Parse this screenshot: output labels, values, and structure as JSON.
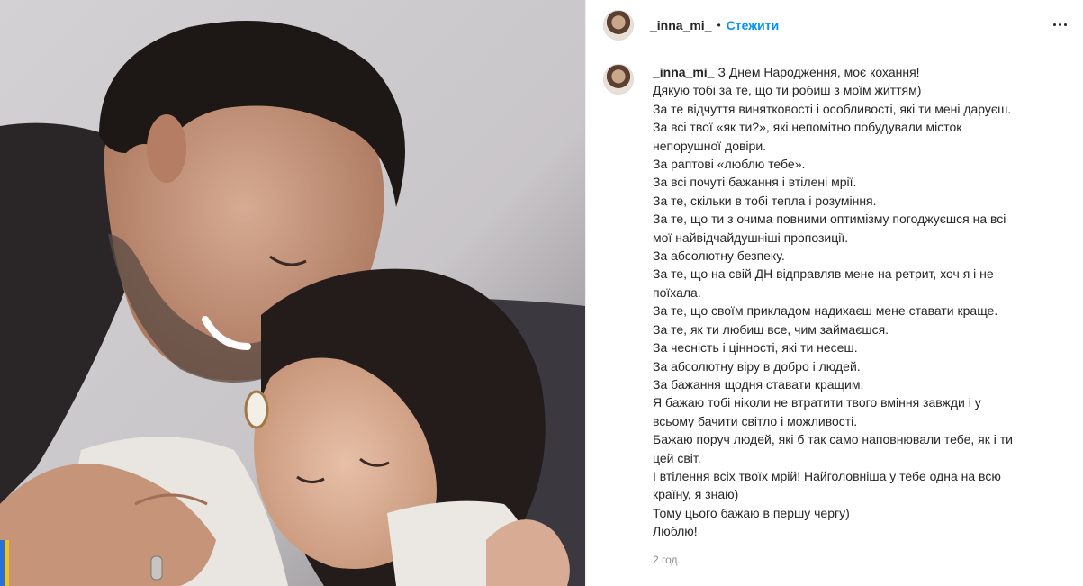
{
  "post": {
    "username": "_inna_mi_",
    "dot": "•",
    "follow_label": "Стежити",
    "more_icon": "more-horizontal-icon"
  },
  "caption": {
    "username": "_inna_mi_",
    "lines": [
      "З Днем Народження, моє кохання!",
      "Дякую тобі за те, що ти робиш з моїм життям)",
      "За те відчуття винятковості і особливості, які ти мені даруєш.",
      "За всі твої «як ти?», які непомітно побудували місток",
      "непорушної довіри.",
      "За раптові «люблю тебе».",
      "За всі почуті бажання і втілені мрії.",
      "За те, скільки в тобі тепла і розуміння.",
      "За те, що ти з очима повними оптимізму погоджуєшся на всі",
      "мої найвідчайдушніші пропозиції.",
      "За абсолютну безпеку.",
      "За те, що на свій ДН відправляв мене на ретрит, хоч я і не",
      "поїхала.",
      "За те, що своїм прикладом надихаєш мене ставати краще.",
      "За те, як ти любиш все, чим займаєшся.",
      "За чесність і цінності, які ти несеш.",
      "За абсолютну віру в добро і людей.",
      "За бажання щодня ставати кращим.",
      "Я бажаю тобі ніколи не втратити твого вміння завжди і у",
      "всьому бачити світло і можливості.",
      "Бажаю поруч людей, які б так само наповнювали тебе, як і ти",
      "цей світ.",
      "І втілення всіх твоїх мрій! Найголовніша у тебе одна на всю",
      "країну, я знаю)",
      "Тому цього бажаю в першу чергу)",
      "Люблю!"
    ],
    "time": "2 год."
  }
}
